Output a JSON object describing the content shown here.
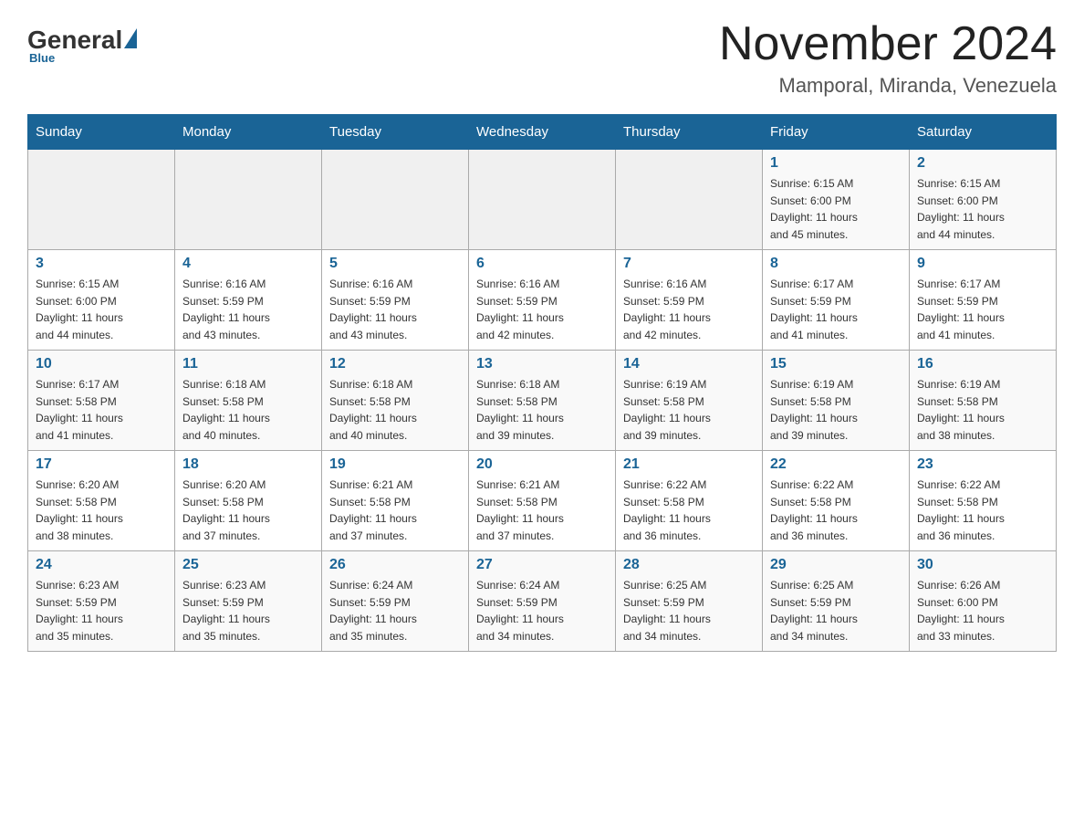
{
  "header": {
    "logo_general": "General",
    "logo_blue": "Blue",
    "logo_sub": "Blue",
    "month_title": "November 2024",
    "location": "Mamporal, Miranda, Venezuela"
  },
  "days_of_week": [
    "Sunday",
    "Monday",
    "Tuesday",
    "Wednesday",
    "Thursday",
    "Friday",
    "Saturday"
  ],
  "weeks": [
    [
      {
        "day": "",
        "info": ""
      },
      {
        "day": "",
        "info": ""
      },
      {
        "day": "",
        "info": ""
      },
      {
        "day": "",
        "info": ""
      },
      {
        "day": "",
        "info": ""
      },
      {
        "day": "1",
        "info": "Sunrise: 6:15 AM\nSunset: 6:00 PM\nDaylight: 11 hours\nand 45 minutes."
      },
      {
        "day": "2",
        "info": "Sunrise: 6:15 AM\nSunset: 6:00 PM\nDaylight: 11 hours\nand 44 minutes."
      }
    ],
    [
      {
        "day": "3",
        "info": "Sunrise: 6:15 AM\nSunset: 6:00 PM\nDaylight: 11 hours\nand 44 minutes."
      },
      {
        "day": "4",
        "info": "Sunrise: 6:16 AM\nSunset: 5:59 PM\nDaylight: 11 hours\nand 43 minutes."
      },
      {
        "day": "5",
        "info": "Sunrise: 6:16 AM\nSunset: 5:59 PM\nDaylight: 11 hours\nand 43 minutes."
      },
      {
        "day": "6",
        "info": "Sunrise: 6:16 AM\nSunset: 5:59 PM\nDaylight: 11 hours\nand 42 minutes."
      },
      {
        "day": "7",
        "info": "Sunrise: 6:16 AM\nSunset: 5:59 PM\nDaylight: 11 hours\nand 42 minutes."
      },
      {
        "day": "8",
        "info": "Sunrise: 6:17 AM\nSunset: 5:59 PM\nDaylight: 11 hours\nand 41 minutes."
      },
      {
        "day": "9",
        "info": "Sunrise: 6:17 AM\nSunset: 5:59 PM\nDaylight: 11 hours\nand 41 minutes."
      }
    ],
    [
      {
        "day": "10",
        "info": "Sunrise: 6:17 AM\nSunset: 5:58 PM\nDaylight: 11 hours\nand 41 minutes."
      },
      {
        "day": "11",
        "info": "Sunrise: 6:18 AM\nSunset: 5:58 PM\nDaylight: 11 hours\nand 40 minutes."
      },
      {
        "day": "12",
        "info": "Sunrise: 6:18 AM\nSunset: 5:58 PM\nDaylight: 11 hours\nand 40 minutes."
      },
      {
        "day": "13",
        "info": "Sunrise: 6:18 AM\nSunset: 5:58 PM\nDaylight: 11 hours\nand 39 minutes."
      },
      {
        "day": "14",
        "info": "Sunrise: 6:19 AM\nSunset: 5:58 PM\nDaylight: 11 hours\nand 39 minutes."
      },
      {
        "day": "15",
        "info": "Sunrise: 6:19 AM\nSunset: 5:58 PM\nDaylight: 11 hours\nand 39 minutes."
      },
      {
        "day": "16",
        "info": "Sunrise: 6:19 AM\nSunset: 5:58 PM\nDaylight: 11 hours\nand 38 minutes."
      }
    ],
    [
      {
        "day": "17",
        "info": "Sunrise: 6:20 AM\nSunset: 5:58 PM\nDaylight: 11 hours\nand 38 minutes."
      },
      {
        "day": "18",
        "info": "Sunrise: 6:20 AM\nSunset: 5:58 PM\nDaylight: 11 hours\nand 37 minutes."
      },
      {
        "day": "19",
        "info": "Sunrise: 6:21 AM\nSunset: 5:58 PM\nDaylight: 11 hours\nand 37 minutes."
      },
      {
        "day": "20",
        "info": "Sunrise: 6:21 AM\nSunset: 5:58 PM\nDaylight: 11 hours\nand 37 minutes."
      },
      {
        "day": "21",
        "info": "Sunrise: 6:22 AM\nSunset: 5:58 PM\nDaylight: 11 hours\nand 36 minutes."
      },
      {
        "day": "22",
        "info": "Sunrise: 6:22 AM\nSunset: 5:58 PM\nDaylight: 11 hours\nand 36 minutes."
      },
      {
        "day": "23",
        "info": "Sunrise: 6:22 AM\nSunset: 5:58 PM\nDaylight: 11 hours\nand 36 minutes."
      }
    ],
    [
      {
        "day": "24",
        "info": "Sunrise: 6:23 AM\nSunset: 5:59 PM\nDaylight: 11 hours\nand 35 minutes."
      },
      {
        "day": "25",
        "info": "Sunrise: 6:23 AM\nSunset: 5:59 PM\nDaylight: 11 hours\nand 35 minutes."
      },
      {
        "day": "26",
        "info": "Sunrise: 6:24 AM\nSunset: 5:59 PM\nDaylight: 11 hours\nand 35 minutes."
      },
      {
        "day": "27",
        "info": "Sunrise: 6:24 AM\nSunset: 5:59 PM\nDaylight: 11 hours\nand 34 minutes."
      },
      {
        "day": "28",
        "info": "Sunrise: 6:25 AM\nSunset: 5:59 PM\nDaylight: 11 hours\nand 34 minutes."
      },
      {
        "day": "29",
        "info": "Sunrise: 6:25 AM\nSunset: 5:59 PM\nDaylight: 11 hours\nand 34 minutes."
      },
      {
        "day": "30",
        "info": "Sunrise: 6:26 AM\nSunset: 6:00 PM\nDaylight: 11 hours\nand 33 minutes."
      }
    ]
  ]
}
